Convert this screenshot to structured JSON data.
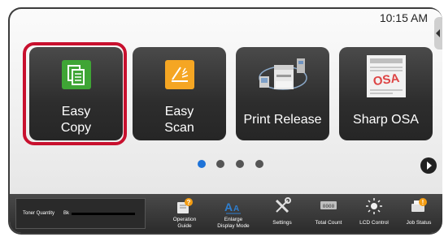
{
  "status": {
    "time": "10:15 AM"
  },
  "tiles": [
    {
      "line1": "Easy",
      "line2": "Copy",
      "icon": "document-copy-icon"
    },
    {
      "line1": "Easy",
      "line2": "Scan",
      "icon": "scanner-icon"
    },
    {
      "label": "Print Release",
      "icon": "printer-network-icon"
    },
    {
      "label": "Sharp OSA",
      "icon": "osa-document-icon"
    }
  ],
  "pagination": {
    "current": 1,
    "total": 4
  },
  "toner": {
    "label": "Toner Quantity",
    "color": "Bk",
    "level_fraction": 1.0
  },
  "bottom_bar": [
    {
      "line1": "Operation",
      "line2": "Guide",
      "icon": "book-help-icon"
    },
    {
      "line1": "Enlarge",
      "line2": "Display Mode",
      "icon": "enlarge-text-icon"
    },
    {
      "line1": "Settings",
      "line2": "",
      "icon": "tools-icon"
    },
    {
      "line1": "Total Count",
      "line2": "",
      "icon": "counter-icon"
    },
    {
      "line1": "LCD Control",
      "line2": "",
      "icon": "brightness-icon"
    },
    {
      "line1": "Job Status",
      "line2": "",
      "icon": "printer-status-icon"
    }
  ],
  "colors": {
    "accent": "#1e73d8",
    "highlight": "#c8102e",
    "copy_icon": "#3fa535",
    "scan_icon": "#f5a623"
  }
}
